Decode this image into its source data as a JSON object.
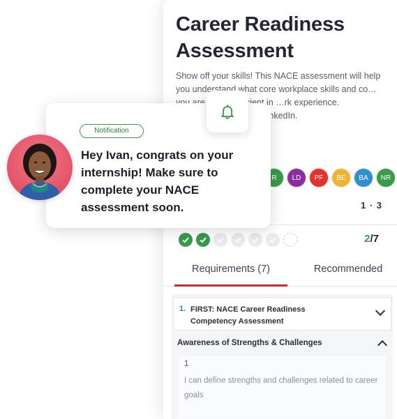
{
  "assessment": {
    "title": "Career Readiness Assessment",
    "description": "Show off your skills! This NACE assessment will help you understand what core workplace skills and co… you are most proficient in …rk experience. Afterwards, …port via LinkedIn.",
    "badges": [
      {
        "label": "R",
        "color": "#3a9a4a"
      },
      {
        "label": "LD",
        "color": "#8a2da0"
      },
      {
        "label": "PF",
        "color": "#e2332a"
      },
      {
        "label": "BE",
        "color": "#f2b233"
      },
      {
        "label": "BA",
        "color": "#2f8fcf"
      },
      {
        "label": "NR",
        "color": "#3a9a4a"
      }
    ],
    "score": "1 · 3",
    "progress": {
      "done": "2",
      "separator": "/",
      "total": "7"
    }
  },
  "tabs": {
    "requirements": "Requirements (7)",
    "recommended": "Recommended"
  },
  "requirements": {
    "item_number": "1.",
    "item_title": "FIRST: NACE Career Readiness Competency Assessment",
    "section_title": "Awareness of Strengths & Challenges",
    "question_number": "1",
    "question_text": "I can define strengths and challenges related to career goals"
  },
  "notification": {
    "badge": "Notification",
    "message": "Hey Ivan, congrats on your internship! Make sure to complete your NACE assessment soon."
  },
  "colors": {
    "accent_green": "#3a9a4a",
    "tab_underline": "#d8262f",
    "link_blue": "#2b7bb9"
  },
  "icons": {
    "bell": "bell-icon",
    "check": "check-icon",
    "chevron_down": "chevron-down-icon",
    "chevron_up": "chevron-up-icon"
  }
}
